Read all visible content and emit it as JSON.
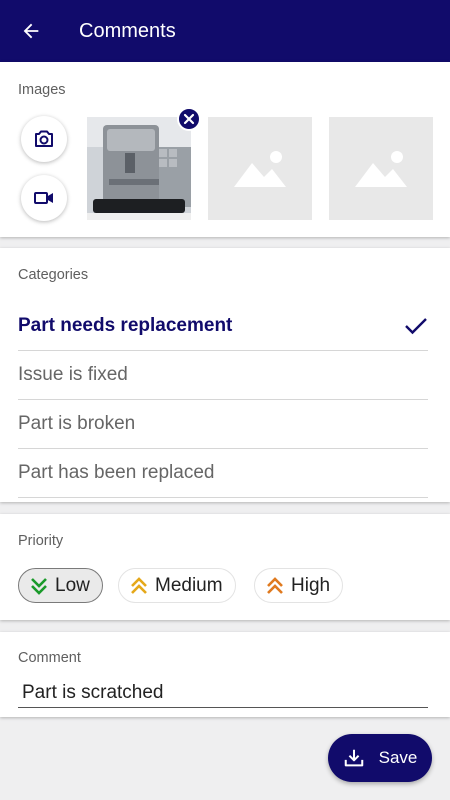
{
  "header": {
    "title": "Comments"
  },
  "images": {
    "label": "Images",
    "buttons": [
      {
        "icon": "camera-icon"
      },
      {
        "icon": "video-camera-icon"
      }
    ],
    "thumbnails": [
      {
        "state": "photo",
        "subject": "coffee machine"
      },
      {
        "state": "placeholder"
      },
      {
        "state": "placeholder"
      }
    ]
  },
  "categories": {
    "label": "Categories",
    "items": [
      {
        "label": "Part needs replacement",
        "selected": true
      },
      {
        "label": "Issue is fixed",
        "selected": false
      },
      {
        "label": "Part is broken",
        "selected": false
      },
      {
        "label": "Part has been replaced",
        "selected": false
      }
    ]
  },
  "priority": {
    "label": "Priority",
    "options": [
      {
        "label": "Low",
        "icon": "chevron-double-down-icon",
        "color": "#1a9a2a",
        "selected": true
      },
      {
        "label": "Medium",
        "icon": "chevron-double-up-icon",
        "color": "#e5a81a",
        "selected": false
      },
      {
        "label": "High",
        "icon": "chevron-double-up-icon",
        "color": "#e07a1f",
        "selected": false
      }
    ]
  },
  "comment": {
    "label": "Comment",
    "value": "Part is scratched"
  },
  "actions": {
    "save_label": "Save"
  },
  "colors": {
    "primary": "#110b6b",
    "background": "#efeff0"
  }
}
